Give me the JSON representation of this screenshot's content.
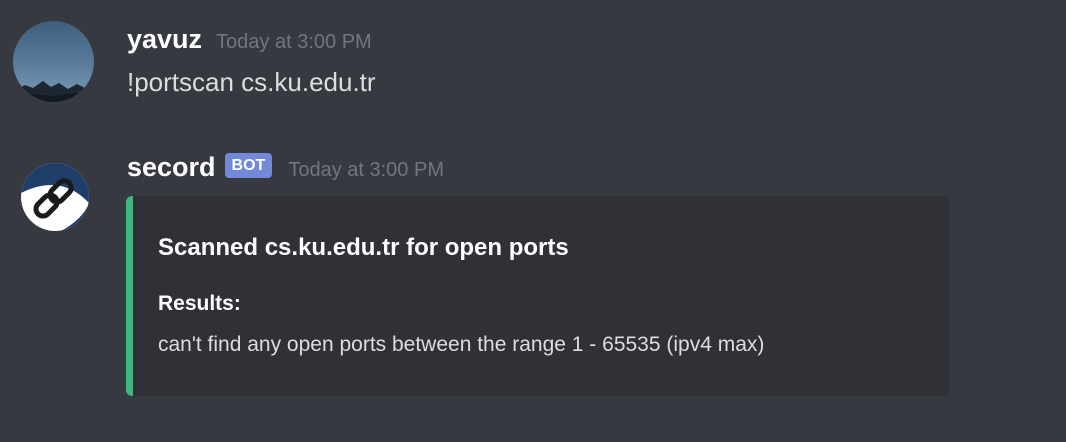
{
  "colors": {
    "background": "#36393f",
    "embed_background": "#2f3136",
    "embed_accent": "#43b581",
    "bot_tag": "#7289da",
    "timestamp": "#72767d"
  },
  "messages": [
    {
      "author": "yavuz",
      "timestamp": "Today at 3:00 PM",
      "content": "!portscan cs.ku.edu.tr",
      "avatar_icon": "landscape-avatar"
    },
    {
      "author": "secord",
      "bot_tag": "BOT",
      "timestamp": "Today at 3:00 PM",
      "avatar_icon": "chain-link-avatar",
      "embed": {
        "title": "Scanned cs.ku.edu.tr for open ports",
        "field_name": "Results:",
        "field_value": "can't find any open ports between the range 1 - 65535 (ipv4 max)"
      }
    }
  ]
}
